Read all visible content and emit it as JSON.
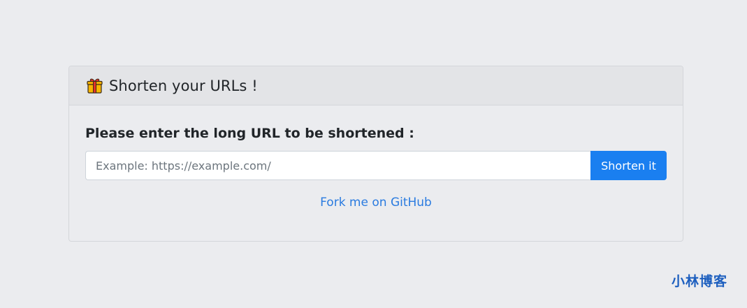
{
  "card": {
    "title": "Shorten your URLs !",
    "icon": "gift-icon"
  },
  "form": {
    "label": "Please enter the long URL to be shortened :",
    "input_placeholder": "Example: https://example.com/",
    "input_value": "",
    "button_label": "Shorten it"
  },
  "footer": {
    "link_text": "Fork me on GitHub"
  },
  "watermark": {
    "text": "小林博客"
  },
  "colors": {
    "page_background": "#ebecef",
    "header_background": "#e3e4e7",
    "button_background": "#1a7ff0",
    "link": "#2a7be0",
    "watermark": "#1d5fbf"
  }
}
